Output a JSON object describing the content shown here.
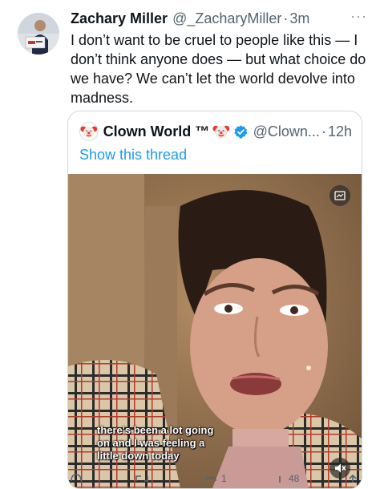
{
  "tweet": {
    "author_name": "Zachary Miller",
    "handle": "@_ZacharyMiller",
    "time": "3m",
    "more": "···",
    "text": "I don’t want to be cruel to people like this — I don’t think anyone does — but what choice do we have? We can’t let the world devolve into madness."
  },
  "quote": {
    "author_name": "Clown World ™",
    "handle": "@Clown...",
    "time": "12h",
    "show_thread": "Show this thread",
    "caption_lines": [
      "there's been a lot going",
      "on and I was feeling a",
      "little down today"
    ]
  },
  "actions": {
    "likes": "1",
    "views": "48"
  },
  "colors": {
    "link": "#1d9bf0",
    "verified": "#1d9bf0",
    "secondary_text": "#536471",
    "border": "#cfd9de"
  },
  "icons": [
    "more-icon",
    "verified-badge-icon",
    "clown-emoji-icon",
    "media-info-icon",
    "mute-icon",
    "reply-icon",
    "retweet-icon",
    "like-icon",
    "views-icon",
    "share-icon"
  ]
}
